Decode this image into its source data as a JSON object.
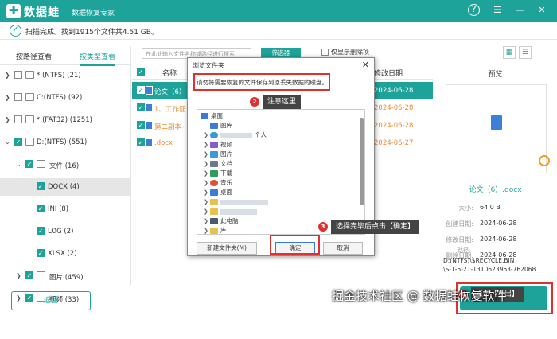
{
  "app": {
    "name": "数据蛙",
    "subtitle": "数据恢复专家",
    "logo": "✚"
  },
  "window": {
    "help": "?",
    "menu": "☰",
    "minimize": "—",
    "close": "✕"
  },
  "status": {
    "text": "扫描完成。找到1915个文件共4.51 GB。"
  },
  "tabs": {
    "path": "按路径查看",
    "type": "按类型查看"
  },
  "tree": [
    {
      "label": "*:(NTFS) (21)"
    },
    {
      "label": "C:(NTFS) (92)"
    },
    {
      "label": "*:(FAT32) (1251)"
    },
    {
      "label": "D:(NTFS) (551)"
    },
    {
      "label": "文件 (16)"
    },
    {
      "label": "DOCX (4)"
    },
    {
      "label": "INI (8)"
    },
    {
      "label": "LOG (2)"
    },
    {
      "label": "XLSX (2)"
    },
    {
      "label": "图片 (459)"
    },
    {
      "label": "视频 (33)"
    }
  ],
  "back_label": "返回",
  "search_placeholder": "在此处输入文件名称或路径进行搜索",
  "filter_label": "筛选器",
  "only_deleted": "仅显示删除项",
  "columns": {
    "name": "名称",
    "date": "修改日期",
    "preview": "预览"
  },
  "files": [
    {
      "name": "论文（6）",
      "date": "2024-06-28"
    },
    {
      "name": "1、工作证",
      "date": "2024-06-28"
    },
    {
      "name": "第二副本-",
      "date": "2024-06-28"
    },
    {
      "name": ".docx",
      "date": "2024-06-27"
    }
  ],
  "preview": {
    "filename": "论文（6）.docx",
    "props": [
      {
        "k": "大小:",
        "v": "64.0 B"
      },
      {
        "k": "创建日期:",
        "v": "2024-06-28"
      },
      {
        "k": "修改日期:",
        "v": "2024-06-28"
      },
      {
        "k": "删除日期:",
        "v": "2024-06-28"
      }
    ],
    "path_label": "路径:",
    "path_line1": "D:(NTFS)\\$RECYCLE.BIN",
    "path_line2": "\\S-1-5-21-1310623963-762068"
  },
  "export_label": "导出",
  "dialog": {
    "title": "浏览文件夹",
    "close": "✕",
    "message": "请勿将需要恢复的文件保存到原丢失数据的磁盘。",
    "nodes": [
      "桌面",
      "图库",
      "个人",
      "视频",
      "图片",
      "文档",
      "下载",
      "音乐",
      "桌面",
      "",
      "",
      "此电脑",
      "库"
    ],
    "new_folder": "新建文件夹(M)",
    "ok": "确定",
    "cancel": "取消"
  },
  "callouts": {
    "c1": {
      "num": "1",
      "text": "点击【导出】"
    },
    "c2": {
      "num": "2",
      "text": "注意这里"
    },
    "c3": {
      "num": "3",
      "text": "选择完毕后点击【确定】"
    }
  },
  "watermark": "掘金技术社区 @ 数据蛙恢复软件",
  "colors": {
    "accent": "#1ea39a",
    "highlight": "#e03030",
    "orange": "#e58b2e"
  }
}
